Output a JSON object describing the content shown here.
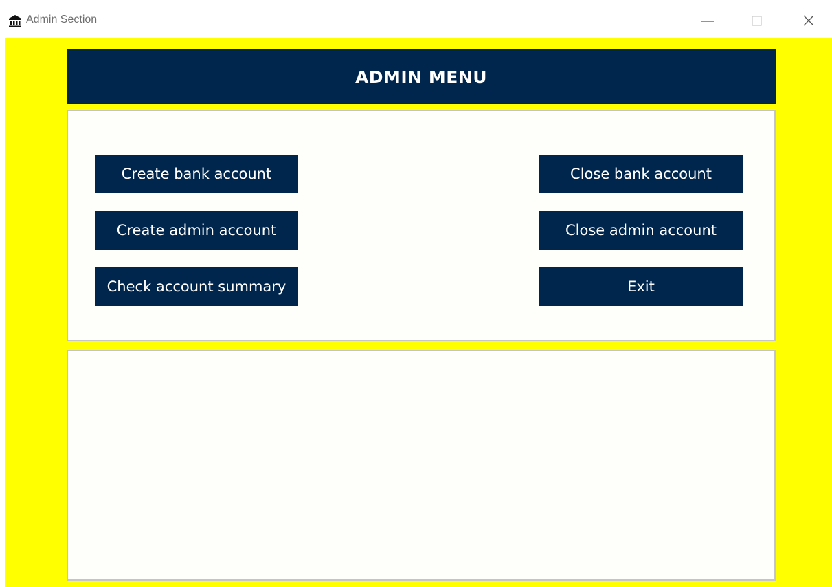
{
  "window": {
    "title": "Admin Section",
    "app_icon": "bank-icon",
    "controls": {
      "minimize_icon": "minimize-icon",
      "maximize_icon": "maximize-icon",
      "close_icon": "close-icon"
    }
  },
  "header": {
    "title": "ADMIN MENU"
  },
  "menu": {
    "left": [
      {
        "label": "Create bank account"
      },
      {
        "label": "Create admin account"
      },
      {
        "label": "Check account summary"
      }
    ],
    "right": [
      {
        "label": "Close bank account"
      },
      {
        "label": "Close admin account"
      },
      {
        "label": "Exit"
      }
    ]
  },
  "output": {
    "text": ""
  },
  "colors": {
    "background": "#ffff00",
    "button": "#00264d",
    "button_text": "#ffffff",
    "panel": "#fefefb",
    "panel_border": "#c5c5c5"
  }
}
